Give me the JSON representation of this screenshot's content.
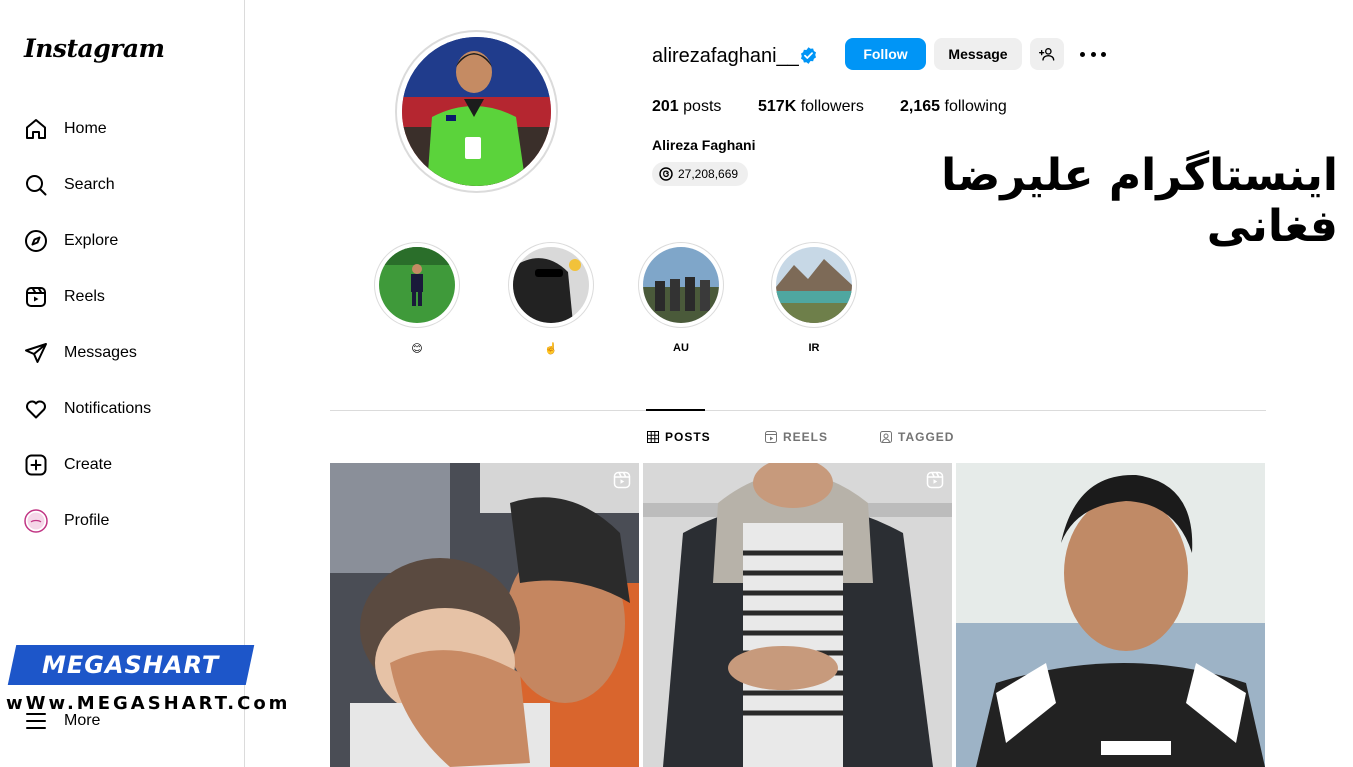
{
  "brand": {
    "logo_text": "Instagram"
  },
  "sidebar": {
    "items": [
      {
        "label": "Home",
        "icon": "home-icon"
      },
      {
        "label": "Search",
        "icon": "search-icon"
      },
      {
        "label": "Explore",
        "icon": "compass-icon"
      },
      {
        "label": "Reels",
        "icon": "reels-icon"
      },
      {
        "label": "Messages",
        "icon": "paper-plane-icon"
      },
      {
        "label": "Notifications",
        "icon": "heart-icon"
      },
      {
        "label": "Create",
        "icon": "plus-square-icon"
      },
      {
        "label": "Profile",
        "icon": "avatar-icon"
      },
      {
        "label": "More",
        "icon": "menu-icon"
      }
    ]
  },
  "profile": {
    "username": "alirezafaghani__",
    "verified": true,
    "follow_label": "Follow",
    "message_label": "Message",
    "stats": {
      "posts_count": "201",
      "posts_label": "posts",
      "followers_count": "517K",
      "followers_label": "followers",
      "following_count": "2,165",
      "following_label": "following"
    },
    "full_name": "Alireza Faghani",
    "threads_count": "27,208,669"
  },
  "overlay": {
    "title": "اینستاگرام علیرضا فغانی"
  },
  "highlights": [
    {
      "label": "😊"
    },
    {
      "label": "☝️"
    },
    {
      "label": "AU"
    },
    {
      "label": "IR"
    }
  ],
  "tabs": [
    {
      "label": "POSTS",
      "active": true
    },
    {
      "label": "REELS",
      "active": false
    },
    {
      "label": "TAGGED",
      "active": false
    }
  ],
  "posts": [
    {
      "type": "reel"
    },
    {
      "type": "reel"
    },
    {
      "type": "photo"
    }
  ],
  "watermark": {
    "brand": "MEGASHART",
    "url": "wWw.MEGASHART.Com"
  },
  "colors": {
    "primary_blue": "#0095f6",
    "button_gray": "#efefef",
    "border": "#dbdbdb",
    "watermark_blue": "#1d56c9"
  }
}
